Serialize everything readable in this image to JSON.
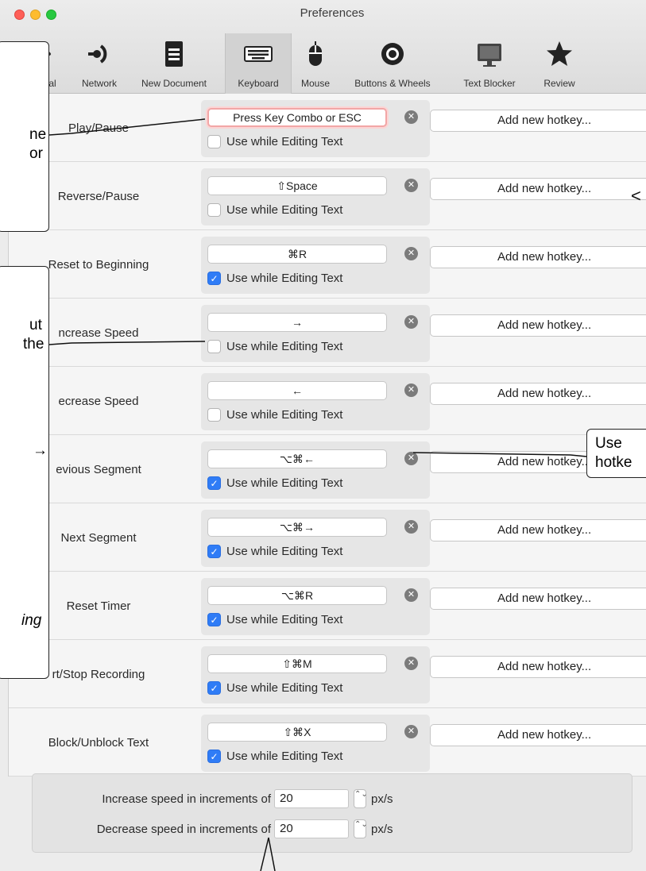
{
  "window": {
    "title": "Preferences"
  },
  "tabs": [
    {
      "id": "general",
      "label": "ral",
      "icon": "general-icon",
      "active": false
    },
    {
      "id": "network",
      "label": "Network",
      "icon": "network-icon",
      "active": false
    },
    {
      "id": "new-document",
      "label": "New Document",
      "icon": "document-icon",
      "active": false
    },
    {
      "id": "keyboard",
      "label": "Keyboard",
      "icon": "keyboard-icon",
      "active": true
    },
    {
      "id": "mouse",
      "label": "Mouse",
      "icon": "mouse-icon",
      "active": false
    },
    {
      "id": "buttons-wheels",
      "label": "Buttons & Wheels",
      "icon": "wheel-icon",
      "active": false
    },
    {
      "id": "text-blocker",
      "label": "Text Blocker",
      "icon": "monitor-icon",
      "active": false
    },
    {
      "id": "review",
      "label": "Review",
      "icon": "star-icon",
      "active": false
    }
  ],
  "hotkeys": [
    {
      "action": "Play/Pause",
      "key": "Press Key Combo or ESC",
      "recording": true,
      "use_while_editing": false,
      "add_label": "Add new hotkey..."
    },
    {
      "action": "Reverse/Pause",
      "key": "⇧Space",
      "recording": false,
      "use_while_editing": false,
      "add_label": "Add new hotkey..."
    },
    {
      "action": "Reset to Beginning",
      "key": "⌘R",
      "recording": false,
      "use_while_editing": true,
      "add_label": "Add new hotkey..."
    },
    {
      "action": "ncrease Speed",
      "key": "→",
      "recording": false,
      "use_while_editing": false,
      "add_label": "Add new hotkey..."
    },
    {
      "action": "ecrease Speed",
      "key": "←",
      "recording": false,
      "use_while_editing": false,
      "add_label": "Add new hotkey..."
    },
    {
      "action": "evious Segment",
      "key": "⌥⌘←",
      "recording": false,
      "use_while_editing": true,
      "add_label": "Add new hotkey..."
    },
    {
      "action": "Next Segment",
      "key": "⌥⌘→",
      "recording": false,
      "use_while_editing": true,
      "add_label": "Add new hotkey..."
    },
    {
      "action": "Reset Timer",
      "key": "⌥⌘R",
      "recording": false,
      "use_while_editing": true,
      "add_label": "Add new hotkey..."
    },
    {
      "action": "rt/Stop Recording",
      "key": "⇧⌘M",
      "recording": false,
      "use_while_editing": true,
      "add_label": "Add new hotkey..."
    },
    {
      "action": "Block/Unblock Text",
      "key": "⇧⌘X",
      "recording": false,
      "use_while_editing": true,
      "add_label": "Add new hotkey..."
    }
  ],
  "labels": {
    "use_while_editing": "Use while Editing Text",
    "clear_glyph": "✕",
    "check_glyph": "✓",
    "stepper_glyph": "⌃⌄"
  },
  "speed": {
    "increase_label": "Increase speed in increments of",
    "increase_value": "20",
    "decrease_label": "Decrease speed in increments of",
    "decrease_value": "20",
    "unit": "px/s"
  },
  "callouts": {
    "top_left": [
      "ne",
      "or"
    ],
    "middle_left": [
      "ut",
      "the",
      "→",
      "ing"
    ],
    "right": [
      "Use",
      "hotke"
    ],
    "arrow_glyph": "<"
  }
}
